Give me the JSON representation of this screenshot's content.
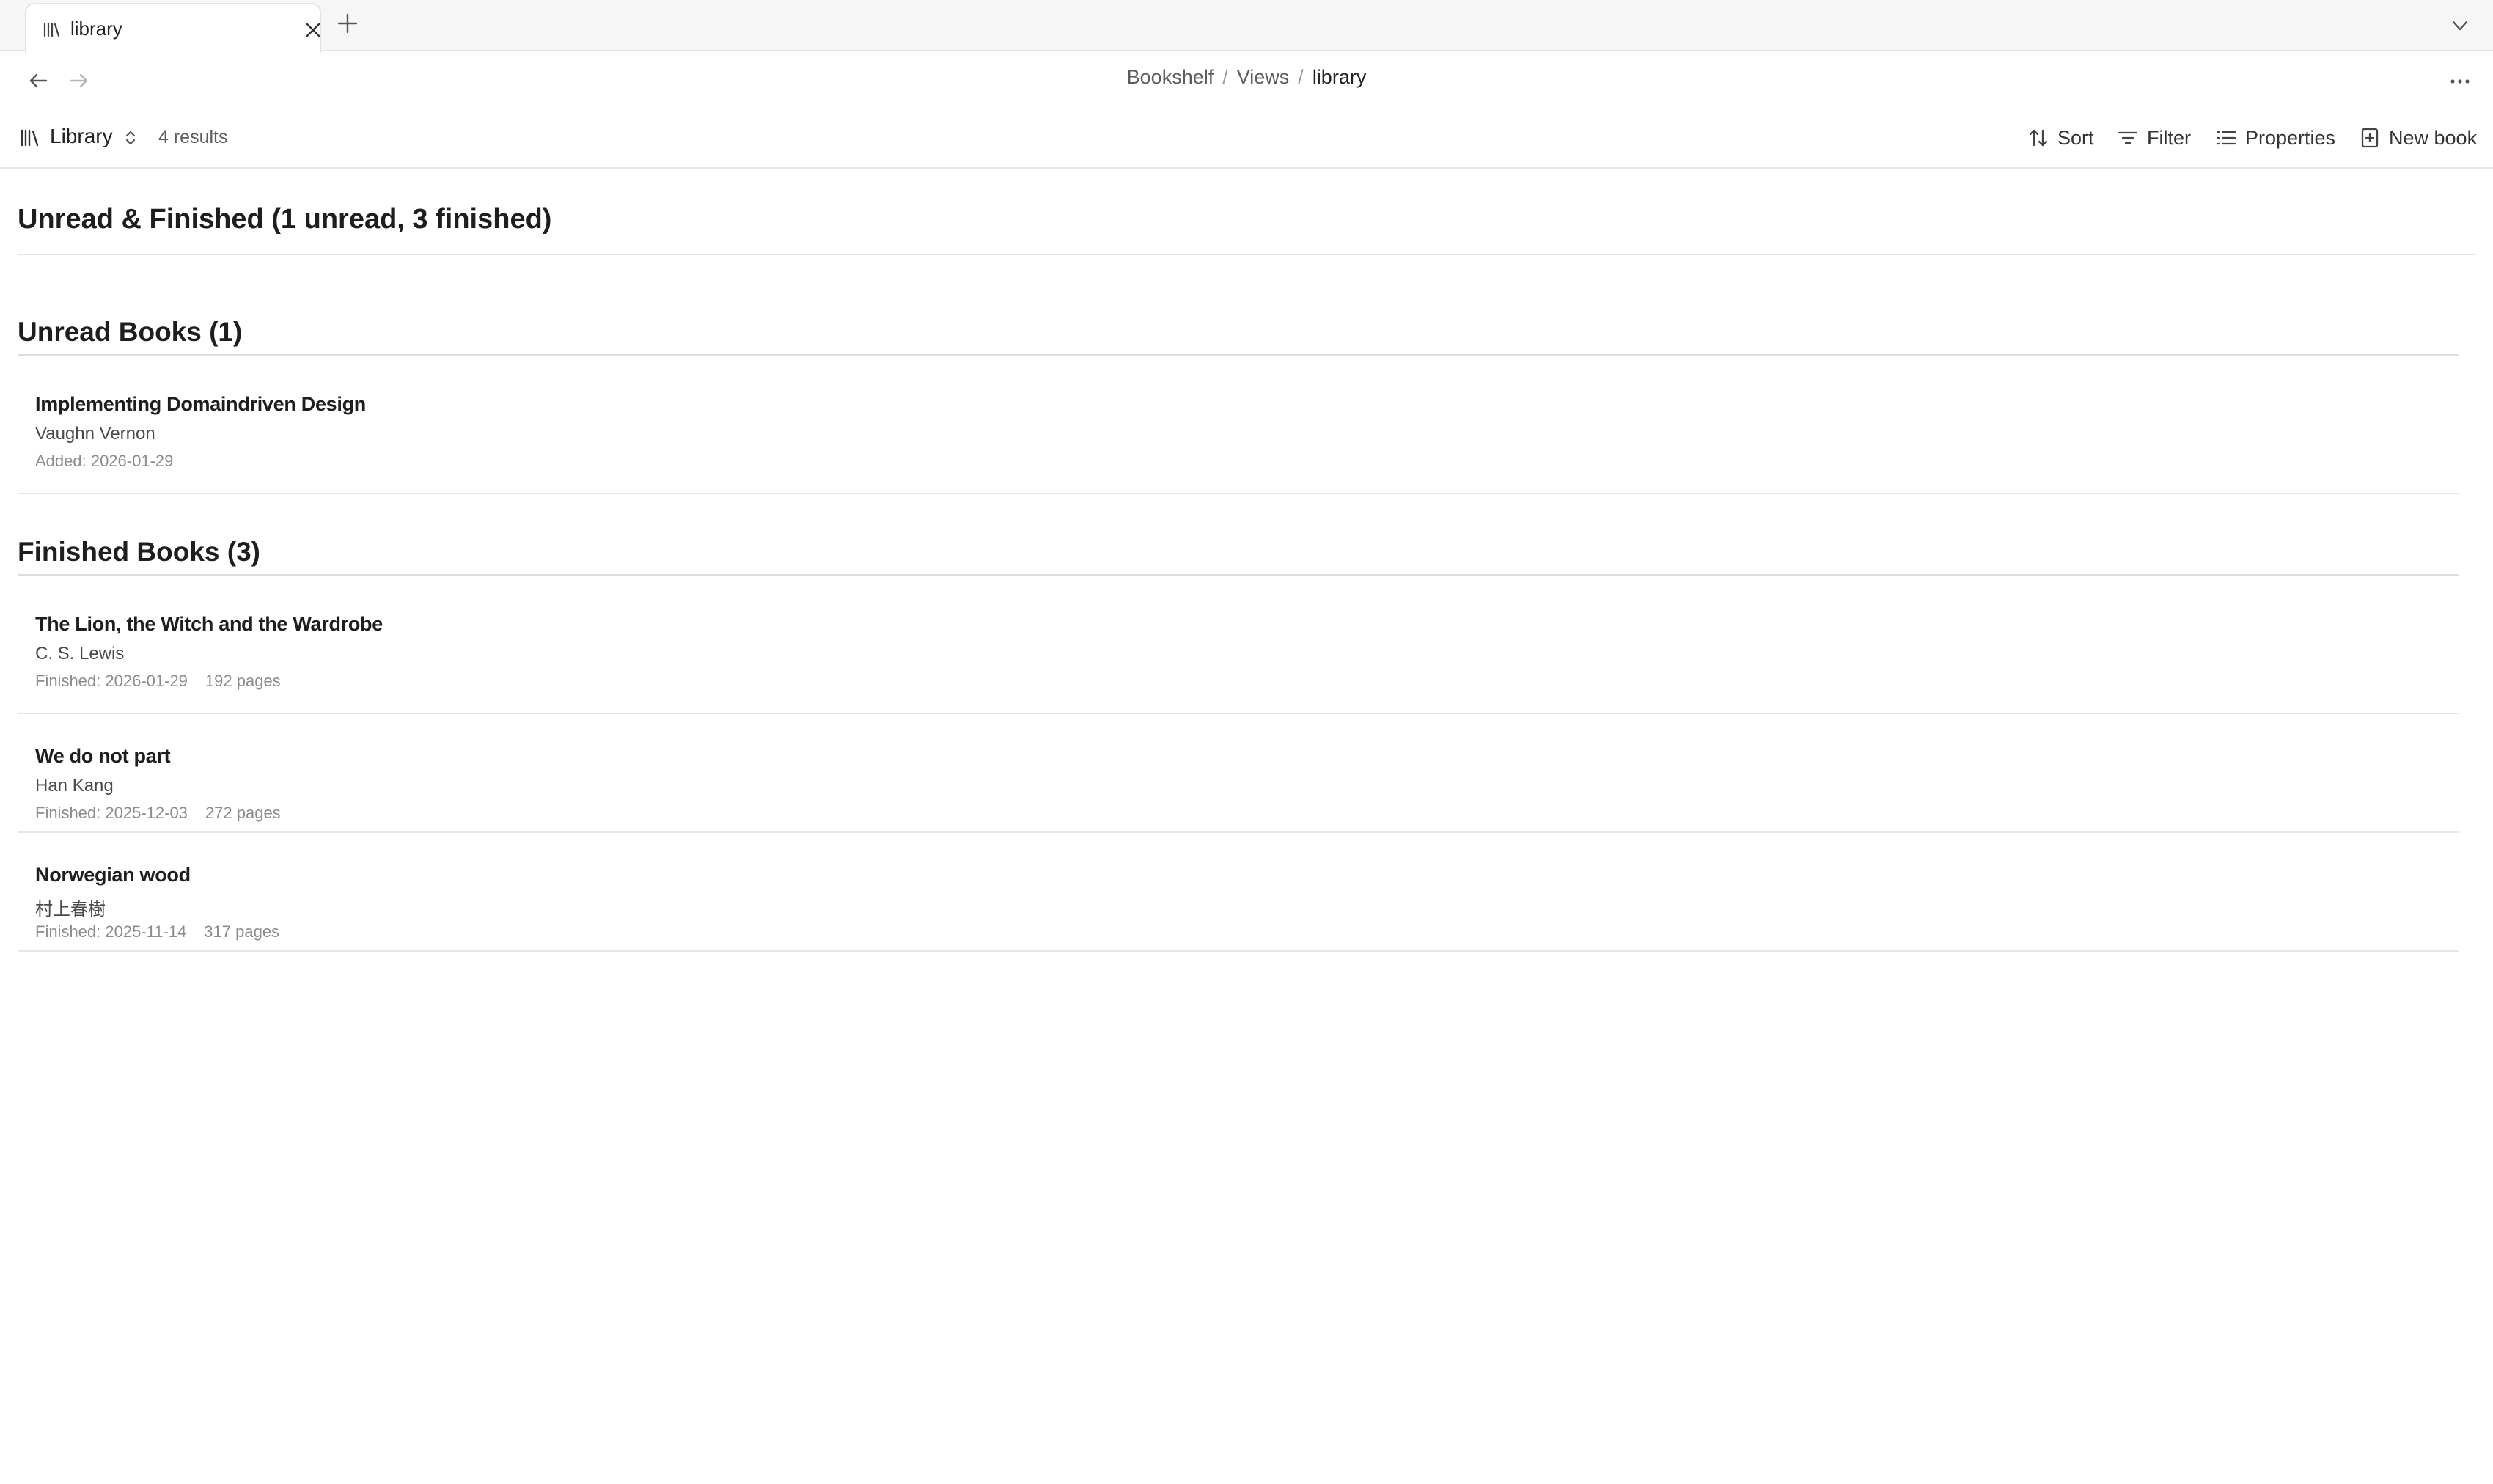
{
  "tabs": [
    {
      "title": "library",
      "icon": "library-icon",
      "active": true
    }
  ],
  "breadcrumb": {
    "items": [
      "Bookshelf",
      "Views",
      "library"
    ],
    "separator": "/"
  },
  "toolbar": {
    "view_name": "Library",
    "results": "4 results",
    "sort_label": "Sort",
    "filter_label": "Filter",
    "properties_label": "Properties",
    "new_book_label": "New book"
  },
  "main": {
    "title": "Unread & Finished (1 unread, 3 finished)",
    "sections": [
      {
        "title": "Unread Books (1)",
        "books": [
          {
            "title": "Implementing Domaindriven Design",
            "author": "Vaughn Vernon",
            "meta1": "Added: 2026-01-29",
            "meta2": ""
          }
        ]
      },
      {
        "title": "Finished Books (3)",
        "books": [
          {
            "title": "The Lion, the Witch and the Wardrobe",
            "author": "C. S. Lewis",
            "meta1": "Finished: 2026-01-29",
            "meta2": "192 pages"
          },
          {
            "title": "We do not part",
            "author": "Han Kang",
            "meta1": "Finished: 2025-12-03",
            "meta2": "272 pages"
          },
          {
            "title": "Norwegian wood",
            "author": "村上春樹",
            "meta1": "Finished: 2025-11-14",
            "meta2": "317 pages"
          }
        ]
      }
    ]
  },
  "colors": {
    "text": "#1e1e1e",
    "muted": "#8c8c8c",
    "border": "#e6e6e6",
    "tabbar": "#f6f6f6"
  }
}
